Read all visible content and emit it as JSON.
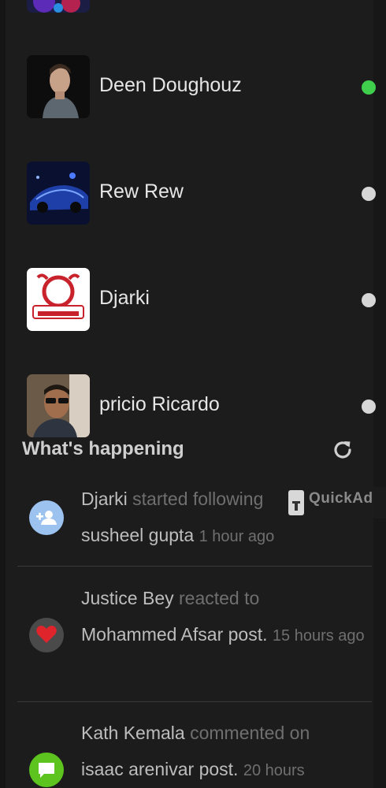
{
  "contacts": [
    {
      "name": "Deen Doughouz",
      "status": "online"
    },
    {
      "name": "Rew Rew",
      "status": "offline"
    },
    {
      "name": "Djarki",
      "status": "offline"
    },
    {
      "name": "pricio Ricardo",
      "status": "offline"
    }
  ],
  "section": {
    "title": "What's happening"
  },
  "feed": [
    {
      "actor": "Djarki",
      "action": "started following",
      "target": "susheel gupta",
      "time": "1 hour ago",
      "icon": "person-add-icon",
      "icon_color": "#9cc2f0"
    },
    {
      "actor": "Justice Bey",
      "action": "reacted to",
      "target": "Mohammed Afsar post.",
      "time": "15 hours ago",
      "icon": "heart-icon",
      "icon_color": "#e0242b"
    },
    {
      "actor": "Kath Kemala",
      "action": "commented on",
      "target": "isaac arenivar post.",
      "time": "20 hours",
      "icon": "comment-icon",
      "icon_color": "#5dc31f"
    }
  ],
  "quickad": {
    "label": "QuickAd"
  },
  "colors": {
    "background": "#1c1c1c",
    "online": "#3fcf4c",
    "offline": "#d6d6d6"
  }
}
